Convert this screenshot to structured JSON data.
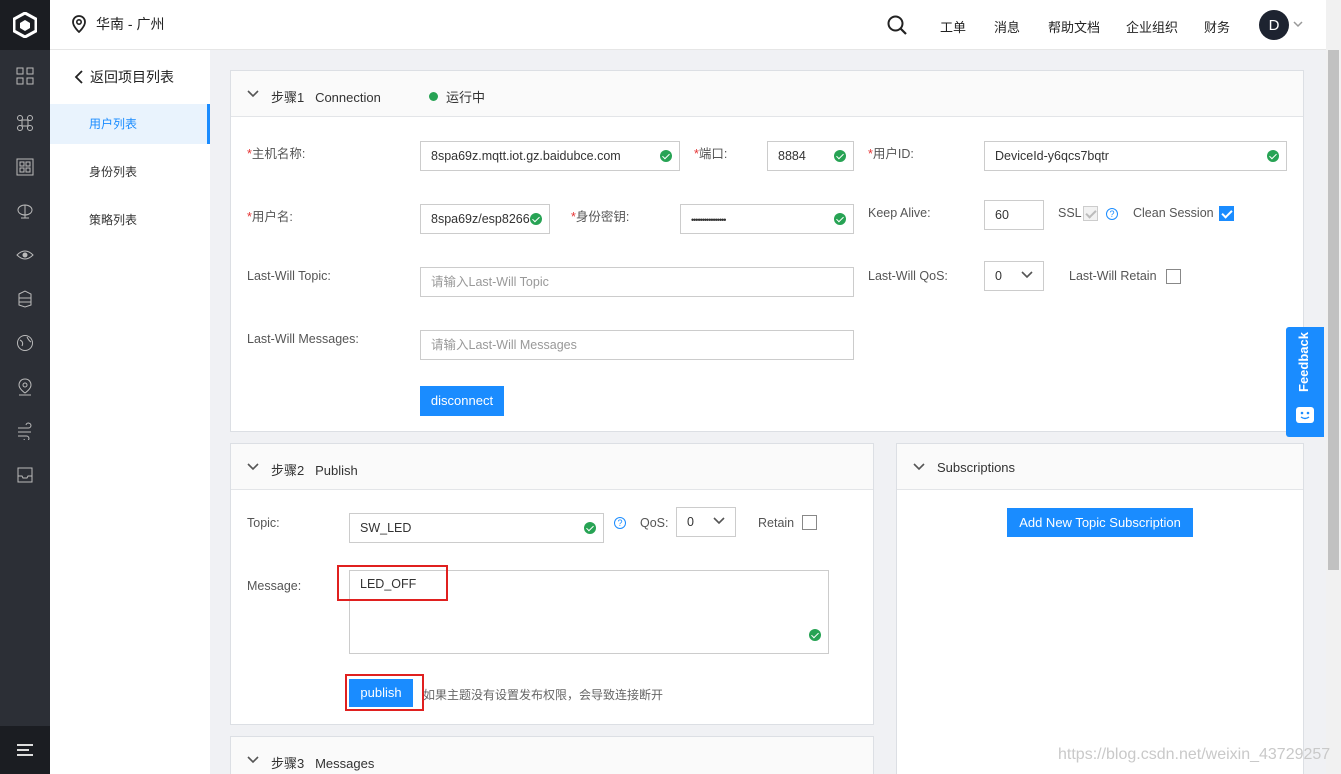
{
  "topbar": {
    "region": "华南 - 广州",
    "nav": [
      "工单",
      "消息",
      "帮助文档",
      "企业组织",
      "财务"
    ],
    "avatar": "D"
  },
  "sidebar": {
    "back_label": "返回项目列表",
    "items": [
      {
        "label": "用户列表",
        "active": true
      },
      {
        "label": "身份列表",
        "active": false
      },
      {
        "label": "策略列表",
        "active": false
      }
    ]
  },
  "step1": {
    "title": "步骤1   Connection",
    "status": "运行中",
    "host_label": "主机名称:",
    "host_value": "8spa69z.mqtt.iot.gz.baidubce.com",
    "port_label": "端口:",
    "port_value": "8884",
    "userid_label": "用户ID:",
    "userid_value": "DeviceId-y6qcs7bqtr",
    "username_label": "用户名:",
    "username_value": "8spa69z/esp8266",
    "secret_label": "身份密钥:",
    "secret_value": "••••••••••••••••",
    "keepalive_label": "Keep Alive:",
    "keepalive_value": "60",
    "ssl_label": "SSL",
    "clean_label": "Clean Session",
    "lw_topic_label": "Last-Will Topic:",
    "lw_topic_placeholder": "请输入Last-Will Topic",
    "lw_qos_label": "Last-Will QoS:",
    "lw_qos_value": "0",
    "lw_retain_label": "Last-Will Retain",
    "lw_msg_label": "Last-Will Messages:",
    "lw_msg_placeholder": "请输入Last-Will Messages",
    "disconnect_label": "disconnect"
  },
  "step2": {
    "title": "步骤2   Publish",
    "topic_label": "Topic:",
    "topic_value": "SW_LED",
    "qos_label": "QoS:",
    "qos_value": "0",
    "retain_label": "Retain",
    "message_label": "Message:",
    "message_value": "LED_OFF",
    "publish_label": "publish",
    "hint": "如果主题没有设置发布权限，会导致连接断开"
  },
  "subscriptions": {
    "title": "Subscriptions",
    "add_label": "Add New Topic Subscription"
  },
  "step3": {
    "title": "步骤3   Messages"
  },
  "feedback_label": "Feedback",
  "watermark": "https://blog.csdn.net/weixin_43729257",
  "colors": {
    "accent": "#1a8cff",
    "success": "#27a354",
    "highlight": "#e0201f",
    "rail": "#2c2f36"
  }
}
